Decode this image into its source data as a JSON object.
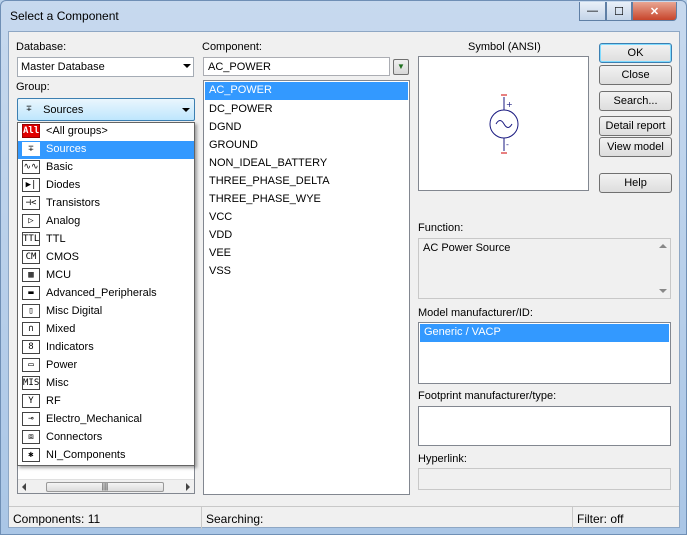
{
  "window": {
    "title": "Select a Component",
    "minimize_glyph": "—",
    "maximize_glyph": "☐",
    "close_glyph": "✕"
  },
  "database": {
    "label": "Database:",
    "value": "Master Database"
  },
  "group": {
    "label": "Group:",
    "value": "Sources",
    "icon": "sources-icon",
    "icon_glyph": "∓"
  },
  "group_dropdown": {
    "items": [
      {
        "label": "<All groups>",
        "icon": "all-groups-icon",
        "glyph": "All"
      },
      {
        "label": "Sources",
        "icon": "sources-icon",
        "glyph": "∓",
        "selected": true
      },
      {
        "label": "Basic",
        "icon": "basic-icon",
        "glyph": "∿∿"
      },
      {
        "label": "Diodes",
        "icon": "diodes-icon",
        "glyph": "▶|"
      },
      {
        "label": "Transistors",
        "icon": "transistors-icon",
        "glyph": "⊣<"
      },
      {
        "label": "Analog",
        "icon": "analog-icon",
        "glyph": "▷"
      },
      {
        "label": "TTL",
        "icon": "ttl-icon",
        "glyph": "TTL"
      },
      {
        "label": "CMOS",
        "icon": "cmos-icon",
        "glyph": "CM"
      },
      {
        "label": "MCU",
        "icon": "mcu-icon",
        "glyph": "▦"
      },
      {
        "label": "Advanced_Peripherals",
        "icon": "advanced-peripherals-icon",
        "glyph": "▬"
      },
      {
        "label": "Misc Digital",
        "icon": "misc-digital-icon",
        "glyph": "▯"
      },
      {
        "label": "Mixed",
        "icon": "mixed-icon",
        "glyph": "∩"
      },
      {
        "label": "Indicators",
        "icon": "indicators-icon",
        "glyph": "8"
      },
      {
        "label": "Power",
        "icon": "power-icon",
        "glyph": "▭"
      },
      {
        "label": "Misc",
        "icon": "misc-icon",
        "glyph": "MISC"
      },
      {
        "label": "RF",
        "icon": "rf-icon",
        "glyph": "Y"
      },
      {
        "label": "Electro_Mechanical",
        "icon": "electro-mechanical-icon",
        "glyph": "⊸"
      },
      {
        "label": "Connectors",
        "icon": "connectors-icon",
        "glyph": "⧈"
      },
      {
        "label": "NI_Components",
        "icon": "ni-components-icon",
        "glyph": "✱"
      }
    ]
  },
  "component": {
    "label": "Component:",
    "search_value": "AC_POWER",
    "filter_icon": "filter-icon",
    "filter_glyph": "▼",
    "items": [
      {
        "label": "AC_POWER",
        "selected": true
      },
      {
        "label": "DC_POWER"
      },
      {
        "label": "DGND"
      },
      {
        "label": "GROUND"
      },
      {
        "label": "NON_IDEAL_BATTERY"
      },
      {
        "label": "THREE_PHASE_DELTA"
      },
      {
        "label": "THREE_PHASE_WYE"
      },
      {
        "label": "VCC"
      },
      {
        "label": "VDD"
      },
      {
        "label": "VEE"
      },
      {
        "label": "VSS"
      }
    ]
  },
  "symbol": {
    "label": "Symbol (ANSI)",
    "icon": "ac-source-symbol-icon"
  },
  "buttons": {
    "ok": "OK",
    "close": "Close",
    "search": "Search...",
    "detail_report": "Detail report",
    "view_model": "View model",
    "help": "Help"
  },
  "function": {
    "label": "Function:",
    "value": "AC Power Source"
  },
  "model_manufacturer": {
    "label": "Model manufacturer/ID:",
    "items": [
      {
        "label": "Generic / VACP",
        "selected": true
      }
    ]
  },
  "footprint": {
    "label": "Footprint manufacturer/type:"
  },
  "hyperlink": {
    "label": "Hyperlink:",
    "value": ""
  },
  "status": {
    "components": "Components: 11",
    "searching": "Searching:",
    "filter": "Filter: off"
  },
  "colors": {
    "selection": "#3399ff",
    "title_gradient_top": "#c7d9ee",
    "close_button": "#c7452b",
    "symbol_terminal": "#d00000"
  }
}
